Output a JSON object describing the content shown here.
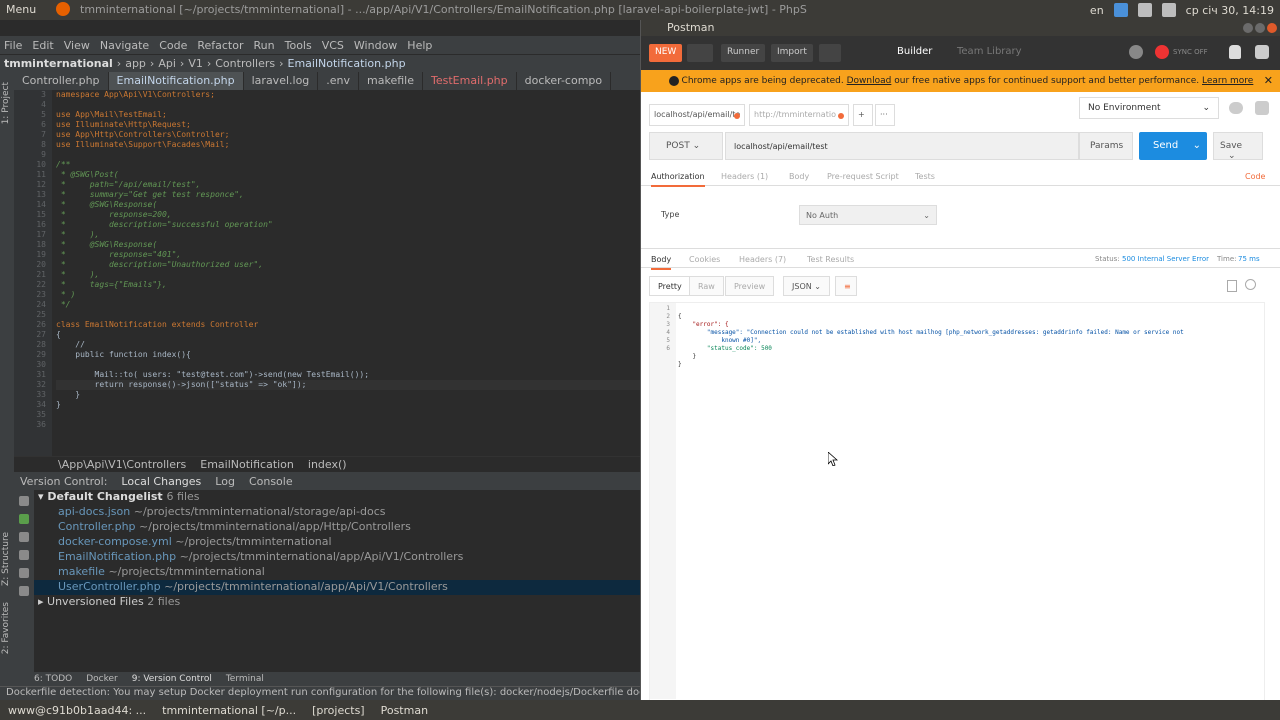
{
  "sysbar": {
    "menu_label": "Menu",
    "window_title": "tmminternational [~/projects/tmminternational] - .../app/Api/V1/Controllers/EmailNotification.php [laravel-api-boilerplate-jwt] - PhpS",
    "lang": "en",
    "clock": "ср січ 30, 14:19"
  },
  "ide": {
    "menu": [
      "File",
      "Edit",
      "View",
      "Navigate",
      "Code",
      "Refactor",
      "Run",
      "Tools",
      "VCS",
      "Window",
      "Help"
    ],
    "breadcrumbs": [
      "tmminternational",
      "app",
      "Api",
      "V1",
      "Controllers",
      "EmailNotification.php"
    ],
    "file_tabs": [
      "Controller.php",
      "EmailNotification.php",
      "laravel.log",
      ".env",
      "makefile",
      "TestEmail.php",
      "docker-compo"
    ],
    "left_strip": [
      "1: Project",
      "Z: Structure",
      "2: Favorites"
    ],
    "line_numbers": [
      "3",
      "4",
      "5",
      "6",
      "7",
      "8",
      "9",
      "10",
      "11",
      "12",
      "13",
      "14",
      "15",
      "16",
      "17",
      "18",
      "19",
      "20",
      "21",
      "22",
      "23",
      "24",
      "25",
      "26",
      "27",
      "28",
      "29",
      "30",
      "31",
      "32",
      "33",
      "34",
      "35",
      "36"
    ],
    "code_lines": [
      "namespace App\\Api\\V1\\Controllers;",
      "",
      "use App\\Mail\\TestEmail;",
      "use Illuminate\\Http\\Request;",
      "use App\\Http\\Controllers\\Controller;",
      "use Illuminate\\Support\\Facades\\Mail;",
      "",
      "/**",
      " * @SWG\\Post(",
      " *     path=\"/api/email/test\",",
      " *     summary=\"Get get test responce\",",
      " *     @SWG\\Response(",
      " *         response=200,",
      " *         description=\"successful operation\"",
      " *     ),",
      " *     @SWG\\Response(",
      " *         response=\"401\",",
      " *         description=\"Unauthorized user\",",
      " *     ),",
      " *     tags={\"Emails\"},",
      " * )",
      " */",
      "",
      "class EmailNotification extends Controller",
      "{",
      "    //",
      "    public function index(){",
      "",
      "        Mail::to( users: \"test@test.com\")->send(new TestEmail());",
      "        return response()->json([\"status\" => \"ok\"]);",
      "    }",
      "}",
      "",
      ""
    ],
    "code_crumbs": [
      "\\App\\Api\\V1\\Controllers",
      "EmailNotification",
      "index()"
    ],
    "vc_header": [
      "Version Control:",
      "Local Changes",
      "Log",
      "Console"
    ],
    "changelist": {
      "title": "Default Changelist",
      "count": "6 files",
      "files": [
        {
          "name": "api-docs.json",
          "path": "~/projects/tmminternational/storage/api-docs"
        },
        {
          "name": "Controller.php",
          "path": "~/projects/tmminternational/app/Http/Controllers"
        },
        {
          "name": "docker-compose.yml",
          "path": "~/projects/tmminternational"
        },
        {
          "name": "EmailNotification.php",
          "path": "~/projects/tmminternational/app/Api/V1/Controllers"
        },
        {
          "name": "makefile",
          "path": "~/projects/tmminternational"
        },
        {
          "name": "UserController.php",
          "path": "~/projects/tmminternational/app/Api/V1/Controllers"
        }
      ],
      "unversioned": "Unversioned Files",
      "unversioned_count": "2 files"
    },
    "bottom_tabs": [
      "6: TODO",
      "Docker",
      "9: Version Control",
      "Terminal"
    ],
    "status": "Dockerfile detection: You may setup Docker deployment run configuration for the following file(s): docker/nodejs/Dockerfile docker/ph"
  },
  "postman": {
    "title": "Postman",
    "toolbar": {
      "new": "NEW",
      "runner": "Runner",
      "import": "Import",
      "builder": "Builder",
      "team_library": "Team Library",
      "sync": "SYNC OFF"
    },
    "banner": {
      "text": "Chrome apps are being deprecated.",
      "link1": "Download",
      "mid": "our free native apps for continued support and better performance.",
      "link2": "Learn more"
    },
    "tabs": [
      "localhost/api/email/te",
      "http://tmminternatio"
    ],
    "environment": "No Environment",
    "method": "POST",
    "url": "localhost/api/email/test",
    "params": "Params",
    "send": "Send",
    "save": "Save",
    "req_tabs": [
      "Authorization",
      "Headers (1)",
      "Body",
      "Pre-request Script",
      "Tests"
    ],
    "code_link": "Code",
    "auth_type_label": "Type",
    "auth_type": "No Auth",
    "resp_tabs": [
      "Body",
      "Cookies",
      "Headers (7)",
      "Test Results"
    ],
    "status_label": "Status:",
    "status_value": "500 Internal Server Error",
    "time_label": "Time:",
    "time_value": "75 ms",
    "view_modes": [
      "Pretty",
      "Raw",
      "Preview"
    ],
    "format": "JSON",
    "resp_lines": [
      "1",
      "2",
      "3",
      "",
      "4",
      "5",
      "6"
    ],
    "json": {
      "l1": "{",
      "l2": "    \"error\": {",
      "l3": "        \"message\": \"Connection could not be established with host mailhog [php_network_getaddresses: getaddrinfo failed: Name or service not",
      "l3b": "            known #0]\",",
      "l4": "        \"status_code\": 500",
      "l5": "    }",
      "l6": "}"
    }
  },
  "taskbar": [
    "www@c91b0b1aad44: ...",
    "tmminternational [~/p...",
    "[projects]",
    "Postman"
  ],
  "colors": {
    "accent": "#f26b3a",
    "send": "#1c8ce0",
    "error": "#1c8ce0",
    "ide_bg": "#2b2b2b"
  }
}
